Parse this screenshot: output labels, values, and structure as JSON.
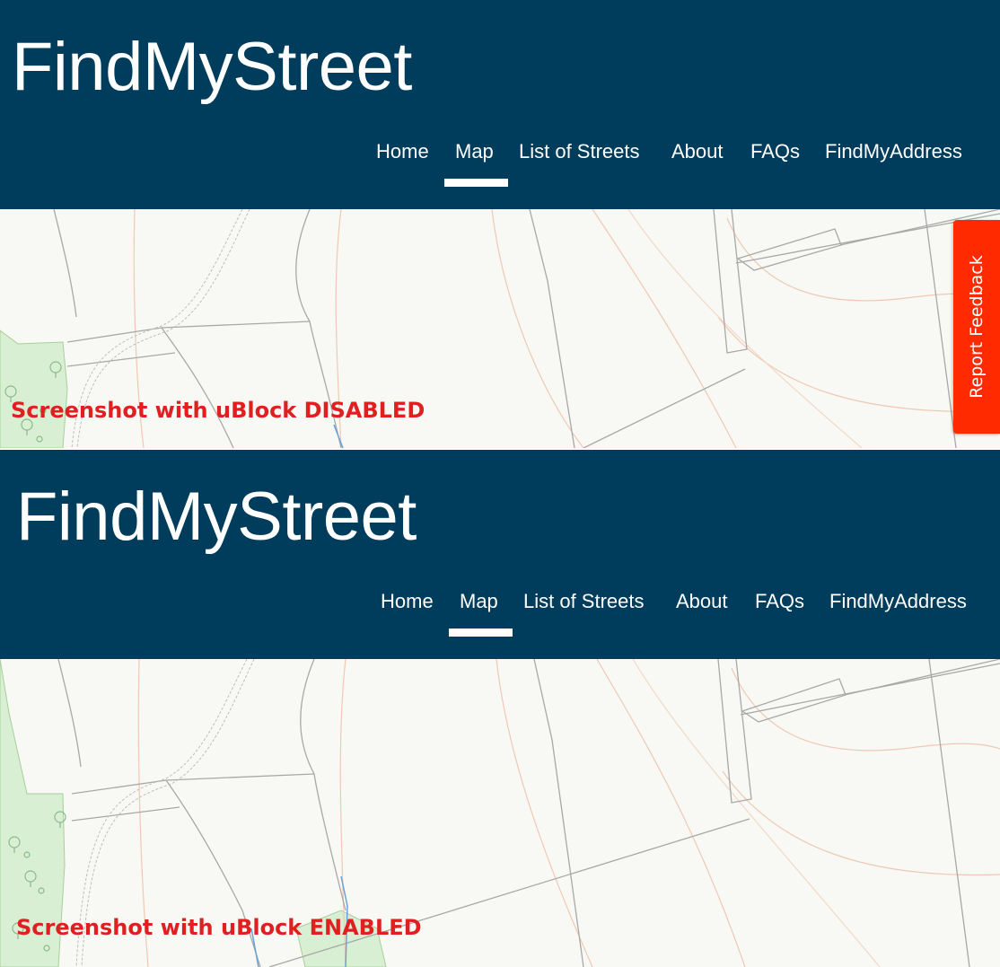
{
  "panels": [
    {
      "site_title": "FindMyStreet",
      "nav": [
        {
          "label": "Home"
        },
        {
          "label": "Map",
          "active": true
        },
        {
          "label": "List of Streets"
        },
        {
          "label": "About"
        },
        {
          "label": "FAQs"
        },
        {
          "label": "FindMyAddress"
        }
      ],
      "caption": "Screenshot with uBlock DISABLED",
      "feedback_tab": "Report Feedback"
    },
    {
      "site_title": "FindMyStreet",
      "nav": [
        {
          "label": "Home"
        },
        {
          "label": "Map",
          "active": true
        },
        {
          "label": "List of Streets"
        },
        {
          "label": "About"
        },
        {
          "label": "FAQs"
        },
        {
          "label": "FindMyAddress"
        }
      ],
      "caption": "Screenshot with uBlock ENABLED"
    }
  ],
  "colors": {
    "header_bg": "#003c5b",
    "caption": "#e02020",
    "feedback_bg": "#ff2a00",
    "map_bg": "#f8f8f4",
    "woodland": "#d9efd3"
  }
}
